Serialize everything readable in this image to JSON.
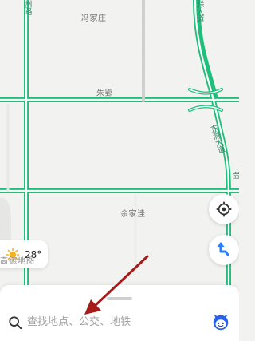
{
  "map": {
    "places": {
      "fengjiazhuang": "冯家庄",
      "zhuying": "朱郢",
      "yujiawa": "余家洼"
    },
    "roads": {
      "left_road_partial": "州路",
      "right_top_road": "滁大道",
      "diagonal_road": "东滁大道",
      "edge_road_partial": "金"
    },
    "watermark": "高德地图",
    "colors": {
      "road_green": "#1fbf7b",
      "road_white": "#ffffff",
      "background": "#f2f2f0",
      "arrow_red": "#b22222",
      "nav_blue": "#2b7cff"
    }
  },
  "weather": {
    "temperature": "28°",
    "icon": "sun-icon"
  },
  "controls": {
    "locate_icon": "locate-icon",
    "navigation_icon": "navigation-icon"
  },
  "search": {
    "placeholder": "查找地点、公交、地铁",
    "icon": "search-icon",
    "assistant_icon": "assistant-icon"
  },
  "annotation": {
    "arrow_color": "#a61a1a"
  }
}
